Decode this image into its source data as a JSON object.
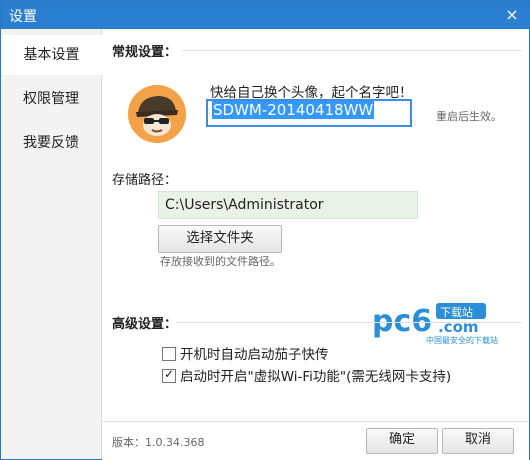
{
  "window": {
    "title": "设置",
    "close_label": "×"
  },
  "sidebar": {
    "items": [
      {
        "label": "基本设置",
        "active": true
      },
      {
        "label": "权限管理",
        "active": false
      },
      {
        "label": "我要反馈",
        "active": false
      }
    ]
  },
  "general": {
    "title": "常规设置：",
    "prompt": "快给自己换个头像，起个名字吧！",
    "name_value": "SDWM-20140418WW",
    "restart_tip": "重启后生效。"
  },
  "storage": {
    "title": "存储路径：",
    "path_value": "C:\\Users\\Administrator",
    "choose_button": "选择文件夹",
    "tip": "存放接收到的文件路径。"
  },
  "advanced": {
    "title": "高级设置：",
    "options": [
      {
        "label": "开机时自动启动茄子快传",
        "checked": false
      },
      {
        "label": "启动时开启\"虚拟Wi-Fi功能\"(需无线网卡支持)",
        "checked": true
      }
    ]
  },
  "footer": {
    "version": "版本：1.0.34.368",
    "ok_button": "确定",
    "cancel_button": "取消"
  },
  "watermark": {
    "logo_text": "pc6",
    "badge": "下载站",
    "domain": ".com",
    "tagline": "中国最安全的下载站"
  },
  "colors": {
    "titlebar": "#2b7fd1",
    "accent": "#3a8ee6"
  }
}
